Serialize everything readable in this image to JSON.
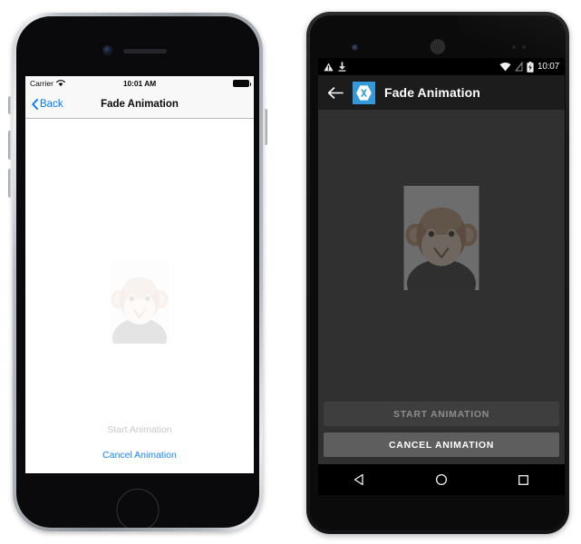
{
  "page": {
    "background": "#ffffff"
  },
  "ios": {
    "device": "iphone",
    "status_bar": {
      "carrier": "Carrier",
      "wifi_icon": "wifi-icon",
      "time": "10:01 AM",
      "battery_icon": "battery-full-icon"
    },
    "nav_bar": {
      "back_icon": "chevron-left-icon",
      "back_label": "Back",
      "title": "Fade Animation"
    },
    "content": {
      "image_alt": "monkey-image",
      "image_opacity": 0.12
    },
    "actions": {
      "start_label": "Start Animation",
      "start_enabled": false,
      "cancel_label": "Cancel Animation",
      "cancel_enabled": true
    },
    "colors": {
      "tint": "#007aff",
      "link": "#1a84ff",
      "disabled_text": "#c9c9cd",
      "bar_background": "#f8f8f8",
      "screen_background": "#ffffff"
    }
  },
  "android": {
    "device": "android-phone",
    "status_bar": {
      "warning_icon": "warning-triangle-icon",
      "download_icon": "download-icon",
      "wifi_icon": "wifi-icon",
      "signal_off_icon": "no-signal-icon",
      "battery_icon": "battery-charging-icon",
      "time": "10:07"
    },
    "toolbar": {
      "back_icon": "arrow-left-icon",
      "app_logo": "xamarin-logo-icon",
      "title": "Fade Animation"
    },
    "content": {
      "image_alt": "monkey-image",
      "image_opacity": 0.32
    },
    "buttons": [
      {
        "label": "START ANIMATION",
        "enabled": false
      },
      {
        "label": "CANCEL ANIMATION",
        "enabled": true
      }
    ],
    "nav_bar": {
      "back_icon": "nav-back-triangle-icon",
      "home_icon": "nav-home-circle-icon",
      "recents_icon": "nav-recents-square-icon"
    },
    "colors": {
      "accent": "#3498db",
      "toolbar_background": "#1c1c1c",
      "screen_background": "#303030",
      "button_disabled": "#3e3e3e",
      "button_enabled": "#5e5e5e",
      "status_background": "#000000"
    }
  }
}
